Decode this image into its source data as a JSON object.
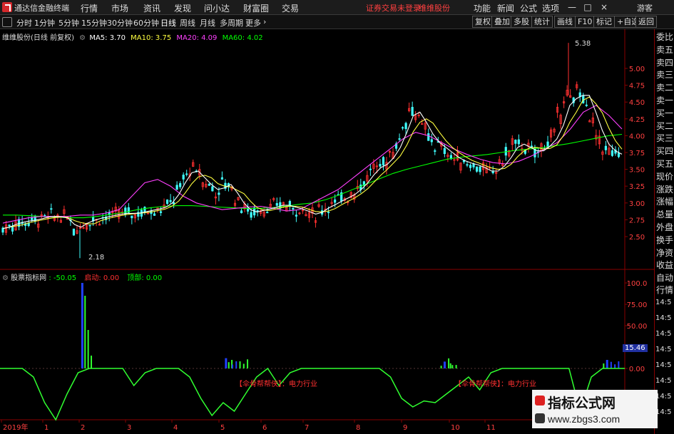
{
  "menubar": {
    "app_title": "通达信金融终端",
    "items": [
      "行情",
      "市场",
      "资讯",
      "发现",
      "问小达",
      "财富圈",
      "交易"
    ],
    "notice": "证券交易未登录",
    "stock_notice": "维维股份",
    "right_items": [
      "功能",
      "新闻",
      "公式",
      "选项"
    ],
    "guest": "游客",
    "min_btn": "—",
    "max_btn": "□",
    "close_btn": "×"
  },
  "toolbar": {
    "periods": [
      "分时",
      "1分钟",
      "5分钟",
      "15分钟",
      "30分钟",
      "60分钟",
      "日线",
      "周线",
      "月线",
      "多周期",
      "更多"
    ],
    "active_period": "日线",
    "right_buttons": [
      "复权",
      "叠加",
      "多股",
      "统计",
      "画线",
      "F10",
      "标记",
      "+自选",
      "返回"
    ]
  },
  "main_chart": {
    "title": "维维股份(日线 前复权)",
    "ma5_label": "MA5: 3.70",
    "ma10_label": "MA10: 3.75",
    "ma20_label": "MA20: 4.09",
    "ma60_label": "MA60: 4.02",
    "high_label": "5.38",
    "low_label": "2.18",
    "colors": {
      "ma5": "#ffffff",
      "ma10": "#ffff40",
      "ma20": "#ff40ff",
      "ma60": "#00ff00",
      "up": "#ff3030",
      "down": "#40ffff"
    }
  },
  "indicator": {
    "name": "股票指标网",
    "value": ": -50.05",
    "label1": "启动: 0.00",
    "label2": "顶部: 0.00",
    "annotation1": "【伞骨帮帮侠】：电力行业",
    "annotation2": "【伞骨帮帮侠】：电力行业"
  },
  "xaxis": {
    "labels": [
      "2019年",
      "1",
      "2",
      "3",
      "4",
      "5",
      "6",
      "7",
      "8",
      "9",
      "10",
      "11"
    ]
  },
  "right_panel": {
    "items": [
      "委比",
      "卖五",
      "卖四",
      "卖三",
      "卖二",
      "卖一",
      "买一",
      "买二",
      "买三",
      "买四",
      "买五",
      "现价",
      "涨跌",
      "涨幅",
      "总量",
      "外盘",
      "换手",
      "净资",
      "收益"
    ],
    "lower_items": [
      "自动",
      "行情"
    ],
    "times": [
      "14:5",
      "14:5",
      "14:5",
      "14:5",
      "14:5",
      "14:5",
      "14:5",
      "14:5"
    ]
  },
  "watermark": {
    "line1": "指标公式网",
    "line2": "www.zbgs3.com"
  },
  "chart_data": {
    "type": "line",
    "price_axis": [
      "5.00",
      "4.75",
      "4.50",
      "4.25",
      "4.00",
      "3.75",
      "3.50",
      "3.25",
      "3.00",
      "2.75",
      "2.50"
    ],
    "indicator_axis": [
      "100.0",
      "75.00",
      "50.00",
      "25.00",
      "0.00"
    ],
    "current_price_label": "15.46",
    "price_points": [
      2.62,
      2.66,
      2.7,
      2.72,
      2.74,
      2.75,
      2.78,
      2.8,
      2.8,
      2.79,
      2.76,
      2.6,
      2.68,
      2.72,
      2.76,
      2.78,
      2.8,
      2.82,
      2.84,
      2.85,
      2.84,
      2.86,
      2.88,
      2.9,
      2.92,
      2.95,
      3.05,
      3.2,
      3.4,
      3.5,
      3.45,
      3.3,
      3.25,
      3.15,
      3.3,
      3.25,
      3.05,
      2.95,
      2.85,
      2.88,
      2.9,
      2.92,
      2.95,
      2.98,
      2.95,
      2.92,
      2.9,
      2.85,
      2.82,
      2.9,
      2.95,
      3.0,
      3.05,
      3.1,
      3.15,
      3.25,
      3.35,
      3.5,
      3.55,
      3.6,
      3.75,
      3.9,
      4.2,
      4.4,
      4.3,
      4.1,
      3.95,
      3.85,
      3.8,
      3.7,
      3.65,
      3.6,
      3.58,
      3.55,
      3.5,
      3.45,
      3.5,
      3.6,
      3.75,
      3.9,
      3.85,
      3.8,
      3.75,
      3.8,
      3.9,
      4.0,
      4.3,
      4.6,
      4.5,
      4.7,
      4.5,
      4.2,
      3.95,
      3.8,
      3.75,
      3.7
    ],
    "ma60_points": [
      2.82,
      2.82,
      2.81,
      2.8,
      2.79,
      2.78,
      2.78,
      2.8,
      2.83,
      2.86,
      2.9,
      2.93,
      2.95,
      2.96,
      2.96,
      2.95,
      2.94,
      2.93,
      2.92,
      2.92,
      2.93,
      2.95,
      2.98,
      3.0,
      3.05,
      3.12,
      3.2,
      3.28,
      3.36,
      3.44,
      3.5,
      3.55,
      3.6,
      3.65,
      3.68,
      3.7,
      3.72,
      3.75,
      3.78,
      3.8,
      3.82,
      3.85,
      3.88,
      3.92,
      3.96,
      4.0,
      4.02
    ],
    "ma20_points": [
      2.7,
      2.74,
      2.78,
      2.8,
      2.8,
      2.8,
      2.82,
      2.82,
      2.85,
      2.9,
      3.1,
      3.3,
      3.35,
      3.25,
      3.1,
      3.0,
      2.95,
      2.9,
      2.92,
      2.94,
      2.95,
      2.92,
      2.88,
      2.9,
      3.0,
      3.1,
      3.2,
      3.35,
      3.5,
      3.65,
      3.8,
      3.95,
      4.05,
      4.0,
      3.9,
      3.8,
      3.72,
      3.65,
      3.6,
      3.58,
      3.62,
      3.7,
      3.8,
      3.9,
      4.1,
      4.35,
      4.45,
      4.3,
      4.1
    ],
    "indicator_line": [
      0,
      0,
      0,
      -10,
      -40,
      -60,
      -30,
      -5,
      0,
      0,
      0,
      0,
      -20,
      -5,
      0,
      0,
      0,
      -10,
      -35,
      -55,
      -40,
      -50,
      -30,
      -10,
      0,
      -20,
      -5,
      0,
      0,
      0,
      0,
      0,
      0,
      0,
      0,
      -10,
      -35,
      -45,
      -38,
      -40,
      -30,
      -20,
      -10,
      -25,
      -5,
      0,
      0,
      0,
      0,
      0,
      0,
      0,
      -50,
      -10,
      0,
      0,
      0
    ],
    "bars_blue": [
      {
        "x": 0.13,
        "v": 100
      },
      {
        "x": 0.36,
        "v": 12
      },
      {
        "x": 0.71,
        "v": 8
      },
      {
        "x": 0.97,
        "v": 10
      }
    ],
    "bars_green": [
      {
        "x": 0.135,
        "v": 85
      },
      {
        "x": 0.14,
        "v": 45
      },
      {
        "x": 0.145,
        "v": 15
      },
      {
        "x": 0.37,
        "v": 10
      },
      {
        "x": 0.72,
        "v": 6
      }
    ]
  }
}
